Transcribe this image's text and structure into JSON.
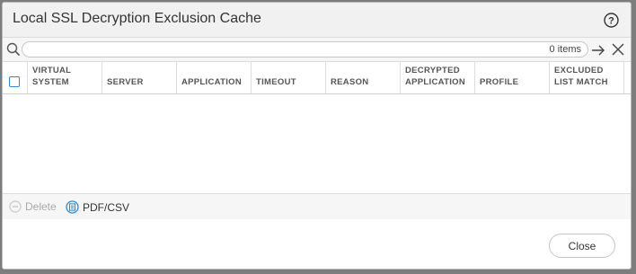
{
  "dialog": {
    "title": "Local SSL Decryption Exclusion Cache"
  },
  "search": {
    "value": "",
    "placeholder": "",
    "item_count": "0 items"
  },
  "table": {
    "columns": [
      {
        "label": "VIRTUAL\nSYSTEM"
      },
      {
        "label": "SERVER"
      },
      {
        "label": "APPLICATION"
      },
      {
        "label": "TIMEOUT"
      },
      {
        "label": "REASON"
      },
      {
        "label": "DECRYPTED\nAPPLICATION"
      },
      {
        "label": "PROFILE"
      },
      {
        "label": "EXCLUDED\nLIST MATCH"
      }
    ],
    "rows": []
  },
  "toolbar": {
    "delete_label": "Delete",
    "pdf_csv_label": "PDF/CSV"
  },
  "footer": {
    "close_label": "Close"
  },
  "colors": {
    "accent": "#2a8bd6",
    "disabled": "#a9a9a9"
  },
  "icons": [
    "help-icon",
    "search-icon",
    "apply-filter-icon",
    "clear-filter-icon",
    "delete-icon",
    "pdf-csv-icon"
  ]
}
